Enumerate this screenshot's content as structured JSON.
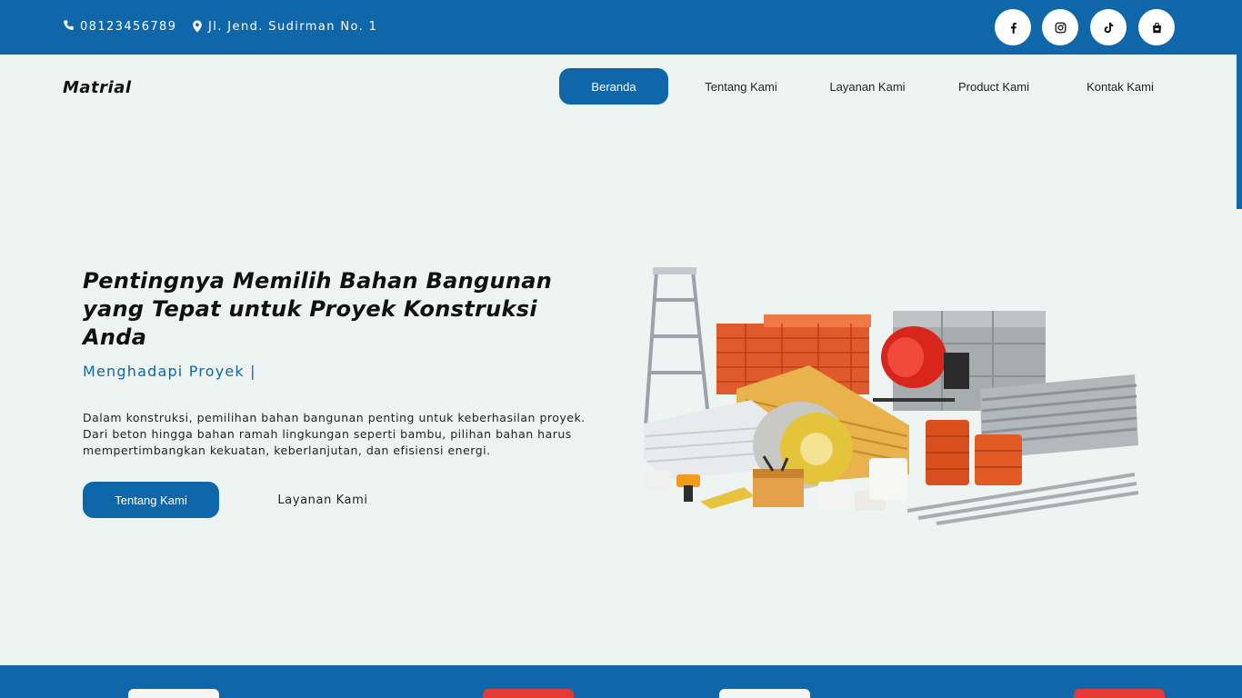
{
  "topbar": {
    "phone": "08123456789",
    "address": "Jl. Jend. Sudirman No. 1",
    "phone_icon": "phone-icon",
    "address_icon": "map-marker-icon",
    "social": [
      "facebook-icon",
      "instagram-icon",
      "tiktok-icon",
      "shopping-bag-icon"
    ]
  },
  "nav": {
    "brand": "Matrial",
    "items": [
      {
        "label": "Beranda",
        "active": true
      },
      {
        "label": "Tentang Kami",
        "active": false
      },
      {
        "label": "Layanan Kami",
        "active": false
      },
      {
        "label": "Product Kami",
        "active": false
      },
      {
        "label": "Kontak Kami",
        "active": false
      }
    ]
  },
  "hero": {
    "title": "Pentingnya Memilih Bahan Bangunan yang Tepat untuk Proyek Konstruksi Anda",
    "typing": "Menghadapi Proyek |",
    "description": "Dalam konstruksi, pemilihan bahan bangunan penting untuk keberhasilan proyek. Dari beton hingga bahan ramah lingkungan seperti bambu, pilihan bahan harus mempertimbangkan kekuatan, keberlanjutan, dan efisiensi energi.",
    "primary_button": "Tentang Kami",
    "secondary_button": "Layanan Kami"
  },
  "colors": {
    "brand_blue": "#0f67aa",
    "page_bg": "#eef4f1",
    "accent_red": "#e53935"
  }
}
